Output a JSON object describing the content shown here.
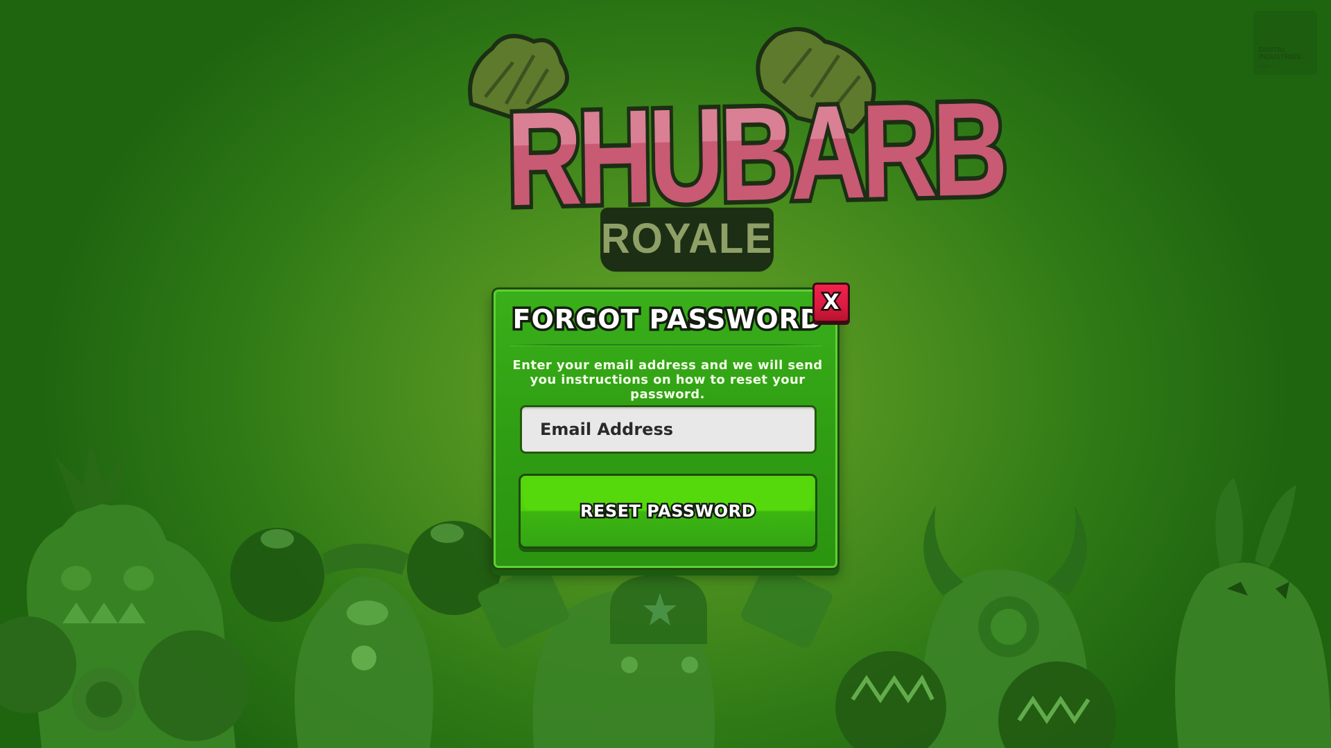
{
  "branding": {
    "logo_title": "RHUBARB",
    "logo_subtitle": "ROYALE",
    "studio_badge_line1": "DIGITAL INDUSTRIES"
  },
  "modal": {
    "title": "FORGOT PASSWORD",
    "description": "Enter your email address and we will send you instructions on how to reset your password.",
    "email_placeholder": "Email Address",
    "email_value": "",
    "submit_label": "RESET PASSWORD",
    "close_label": "X"
  },
  "colors": {
    "background": "#3f8a1c",
    "panel_green": "#2f9d13",
    "button_green": "#4fd009",
    "close_red": "#da1a3f",
    "logo_pink": "#c85a74"
  },
  "icons": {
    "close": "close-icon",
    "rhubarb_leaves": "rhubarb-leaf-icon"
  }
}
